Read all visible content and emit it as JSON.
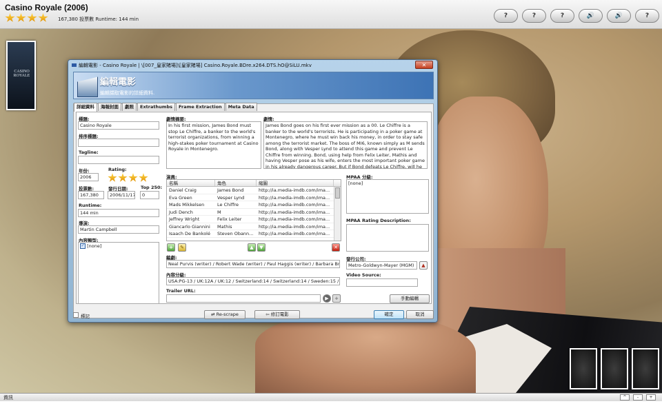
{
  "app": {
    "movie_title": "Casino Royale  (2006)",
    "rating_stars": 4,
    "votes_runtime": "167,380 投票數  Runtime: 144 min",
    "toolbar_buttons": [
      "?",
      "?",
      "?",
      "🔊",
      "🔊",
      "?"
    ],
    "poster_text": "CASINO ROYALE",
    "bottom_label": "資訊",
    "bottom_buttons": [
      "^",
      "-",
      "+"
    ]
  },
  "dialog": {
    "title": "編輯電影 - Casino Royale  | \\[007_皇家賭場]\\[皇家賭場] Casino.Royale.BDre.x264.DTS.hO@SiLU.mkv",
    "close_label": "✕",
    "banner_title": "編輯電影",
    "banner_subtitle": "編輯擷取電影的詳細資料.",
    "tabs": [
      "詳細資料",
      "海報封面",
      "劇照",
      "Extrathumbs",
      "Frame Extraction",
      "Meta Data"
    ],
    "labels": {
      "title": "標題:",
      "sort_title": "排序標題:",
      "tagline": "Tagline:",
      "year": "年份:",
      "rating": "Rating:",
      "votes": "投票數:",
      "release": "發行日期:",
      "top250": "Top 250:",
      "runtime": "Runtime:",
      "director": "導演:",
      "genre": "內容類型:",
      "outline": "劇情摘要:",
      "plot": "劇情:",
      "actors": "演員:",
      "mpaa": "MPAA 分級:",
      "mpaa_desc": "MPAA Rating Description:",
      "credits": "編劇:",
      "studio": "發行公司:",
      "certification": "內容分級:",
      "video_source": "Video Source:",
      "trailer": "Trailer URL:"
    },
    "values": {
      "title": "Casino Royale",
      "sort_title": "",
      "tagline": "",
      "year": "2006",
      "votes": "167,380",
      "release": "2006/11/17",
      "top250": "0",
      "runtime": "144 min",
      "director": "Martin Campbell",
      "genre": "[none]",
      "mpaa": "[none]",
      "mpaa_desc": "",
      "credits": "Neal Purvis (writer) / Robert Wade (writer) / Paul Haggis (writer) / Barbara Brocc",
      "studio": "Metro-Goldwyn-Mayer (MGM)",
      "certification": "USA:PG-13 / UK:12A / UK:12 / Switzerland:14 / Switzerland:14 / Sweden:15 / Spa",
      "video_source": "",
      "trailer": "",
      "outline": "In his first mission, James Bond must stop Le Chiffre, a banker to the world's terrorist organizations, from winning a high-stakes poker tournament at Casino Royale in Montenegro.",
      "plot": "James Bond goes on his first ever mission as a 00. Le Chiffre is a banker to the world's terrorists. He is participating in a poker game at Montenegro, where he must win back his money, in order to stay safe among the terrorist market. The boss of MI6, known simply as M sends Bond, along with Vesper Lynd to attend this game and prevent Le Chiffre from winning. Bond, using help from Felix Leiter, Mathis and having Vesper pose as his wife, enters the most important poker game in his already dangerous career. But if Bond defeats Le Chiffre, will he"
    },
    "actor_columns": [
      "名稱",
      "角色",
      "縮圖"
    ],
    "actors": [
      [
        "Daniel Craig",
        "James Bond",
        "http://ia.media-imdb.com/ima..."
      ],
      [
        "Eva Green",
        "Vesper Lynd",
        "http://ia.media-imdb.com/ima..."
      ],
      [
        "Mads Mikkelsen",
        "Le Chiffre",
        "http://ia.media-imdb.com/ima..."
      ],
      [
        "Judi Dench",
        "M",
        "http://ia.media-imdb.com/ima..."
      ],
      [
        "Jeffrey Wright",
        "Felix Leiter",
        "http://ia.media-imdb.com/ima..."
      ],
      [
        "Giancarlo Giannini",
        "Mathis",
        "http://ia.media-imdb.com/ima..."
      ],
      [
        "Isaach De Bankolé",
        "Steven Obann...",
        "http://ia.media-imdb.com/ima..."
      ]
    ],
    "buttons": {
      "manual": "手動編輯",
      "mark": "標記",
      "rescrape": "Re-scrape",
      "edit_movie": "修訂電影",
      "ok": "確定",
      "cancel": "取消"
    }
  }
}
